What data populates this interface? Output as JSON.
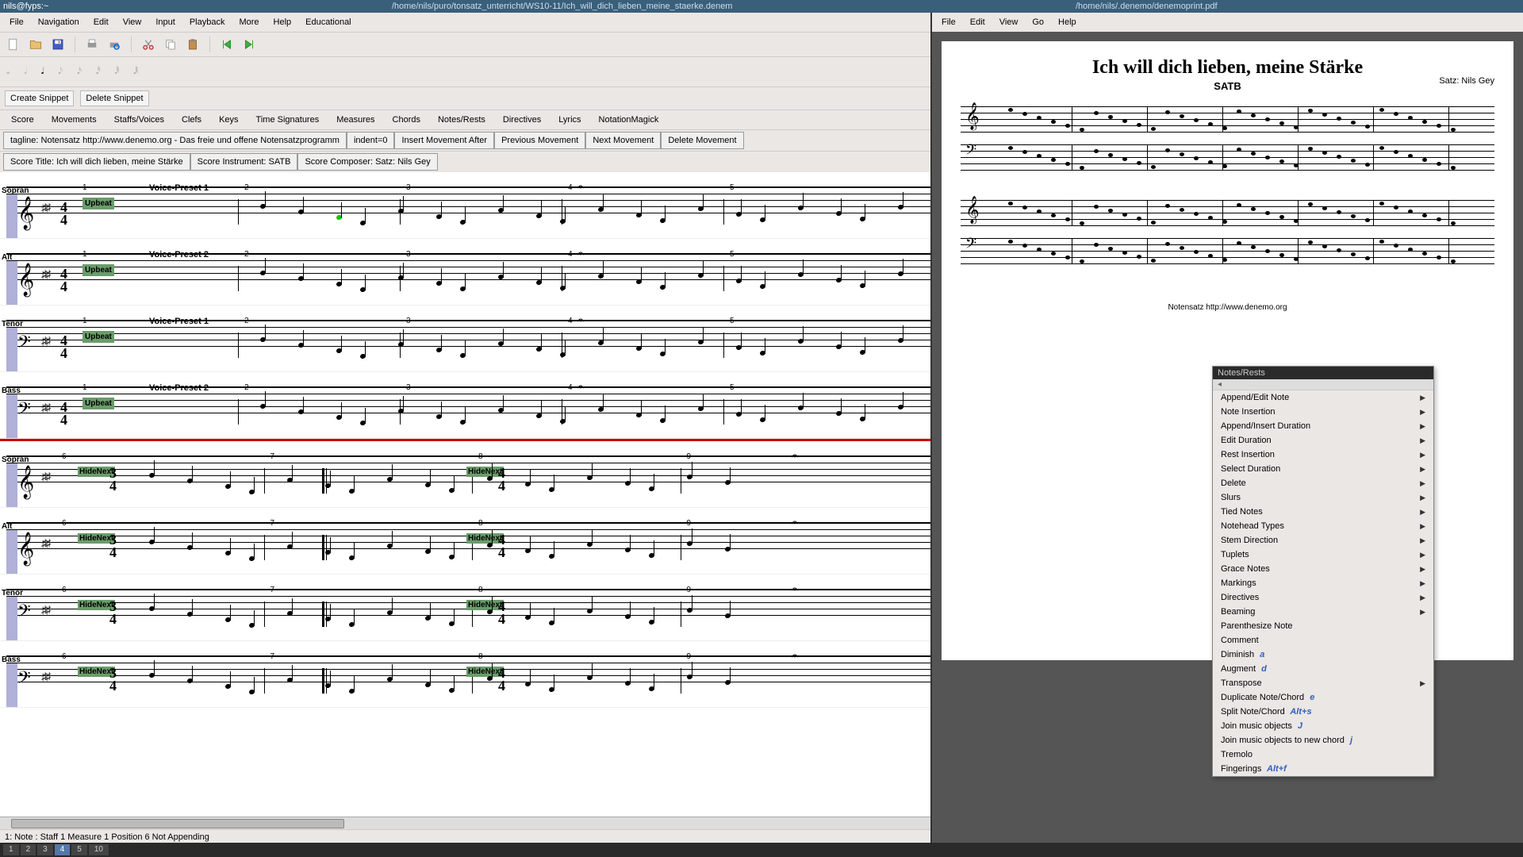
{
  "wm": {
    "user": "nils@fyps:~",
    "title_left": "/home/nils/puro/tonsatz_unterricht/WS10-11/Ich_will_dich_lieben_meine_staerke.denem",
    "title_right": "/home/nils/.denemo/denemoprint.pdf"
  },
  "left": {
    "menubar": [
      "File",
      "Navigation",
      "Edit",
      "View",
      "Input",
      "Playback",
      "More",
      "Help",
      "Educational"
    ],
    "snippets": {
      "create": "Create Snippet",
      "delete": "Delete Snippet"
    },
    "tabs": [
      "Score",
      "Movements",
      "Staffs/Voices",
      "Clefs",
      "Keys",
      "Time Signatures",
      "Measures",
      "Chords",
      "Notes/Rests",
      "Directives",
      "Lyrics",
      "NotationMagick"
    ],
    "row1": {
      "tagline": "tagline: Notensatz http://www.denemo.org  - Das freie und offene Notensatzprogramm",
      "indent": "indent=0",
      "ins_after": "Insert Movement After",
      "prev": "Previous Movement",
      "next": "Next Movement",
      "del": "Delete Movement"
    },
    "row2": {
      "title": "Score Title: Ich will dich lieben, meine Stärke",
      "instrument": "Score Instrument: SATB",
      "composer": "Score Composer: Satz: Nils Gey"
    },
    "staves_sys1": [
      {
        "name": "Sopran",
        "clef": "𝄞",
        "bass": false,
        "preset": "Voice-Preset 1"
      },
      {
        "name": "Alt",
        "clef": "𝄞",
        "bass": false,
        "preset": "Voice-Preset 2"
      },
      {
        "name": "Tenor",
        "clef": "𝄢",
        "bass": true,
        "preset": "Voice-Preset 1"
      },
      {
        "name": "Bass",
        "clef": "𝄢",
        "bass": true,
        "preset": "Voice-Preset 2"
      }
    ],
    "sys1_measures": [
      "1",
      "2",
      "3",
      "4",
      "5"
    ],
    "sys1_upbeat": "Upbeat",
    "staves_sys2": [
      {
        "name": "Sopran",
        "clef": "𝄞",
        "bass": false
      },
      {
        "name": "Alt",
        "clef": "𝄞",
        "bass": false
      },
      {
        "name": "Tenor",
        "clef": "𝄢",
        "bass": true
      },
      {
        "name": "Bass",
        "clef": "𝄢",
        "bass": true
      }
    ],
    "sys2_measures": [
      "6",
      "7",
      "8",
      "9"
    ],
    "sys2_hide": "HideNext",
    "sys2_ts_34": "3\n4",
    "sys2_ts_44": "4\n4",
    "timesig": "4\n4",
    "status": "1: Note :  Staff 1 Measure 1 Position 6 Not Appending"
  },
  "right": {
    "menubar": [
      "File",
      "Edit",
      "View",
      "Go",
      "Help"
    ],
    "title": "Ich will dich lieben, meine Stärke",
    "subtitle": "SATB",
    "composer": "Satz: Nils Gey",
    "tagline": "Notensatz http://www.denemo.org"
  },
  "context_menu": {
    "title": "Notes/Rests",
    "items": [
      {
        "label": "Append/Edit Note",
        "sub": true
      },
      {
        "label": "Note Insertion",
        "sub": true
      },
      {
        "label": "Append/Insert Duration",
        "sub": true
      },
      {
        "label": "Edit Duration",
        "sub": true
      },
      {
        "label": "Rest Insertion",
        "sub": true
      },
      {
        "label": "Select Duration",
        "sub": true
      },
      {
        "label": "Delete",
        "sub": true
      },
      {
        "label": "Slurs",
        "sub": true
      },
      {
        "label": "Tied Notes",
        "sub": true
      },
      {
        "label": "Notehead Types",
        "sub": true
      },
      {
        "label": "Stem Direction",
        "sub": true
      },
      {
        "label": "Tuplets",
        "sub": true
      },
      {
        "label": "Grace Notes",
        "sub": true
      },
      {
        "label": "Markings",
        "sub": true
      },
      {
        "label": "Directives",
        "sub": true
      },
      {
        "label": "Beaming",
        "sub": true
      },
      {
        "label": "Parenthesize Note"
      },
      {
        "label": "Comment"
      },
      {
        "label": "Diminish",
        "key": "a"
      },
      {
        "label": "Augment",
        "key": "d"
      },
      {
        "label": "Transpose",
        "sub": true
      },
      {
        "label": "Duplicate Note/Chord",
        "key": "e"
      },
      {
        "label": "Split Note/Chord",
        "key": "Alt+s"
      },
      {
        "label": "Join music objects",
        "key": "J"
      },
      {
        "label": "Join music objects to new chord",
        "key": "j"
      },
      {
        "label": "Tremolo"
      },
      {
        "label": "Fingerings",
        "key": "Alt+f"
      }
    ]
  },
  "bottom_tabs": [
    "1",
    "2",
    "3",
    "4",
    "5",
    "10"
  ],
  "bottom_active": 3
}
